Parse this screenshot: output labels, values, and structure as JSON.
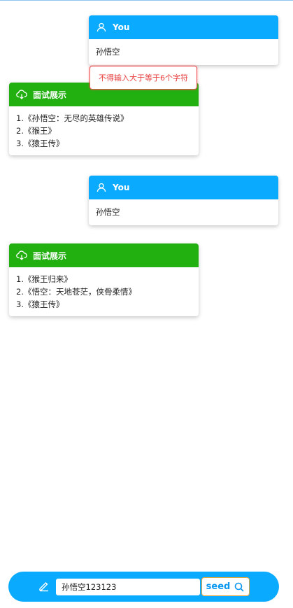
{
  "colors": {
    "user_header": "#0aaaff",
    "bot_header": "#22b011",
    "error": "#e83f3f",
    "bottom_bar": "#0aaaff",
    "seed_border": "#e8a33a"
  },
  "messages": [
    {
      "role": "user",
      "icon": "user-icon",
      "header": "You",
      "text": "孙悟空"
    },
    {
      "role": "bot",
      "icon": "cloud-download-icon",
      "header": "面试展示",
      "lines": [
        "1.《孙悟空：无尽的英雄传说》",
        "2.《猴王》",
        "3.《猿王传》"
      ]
    },
    {
      "role": "user",
      "icon": "user-icon",
      "header": "You",
      "text": "孙悟空"
    },
    {
      "role": "bot",
      "icon": "cloud-download-icon",
      "header": "面试展示",
      "lines": [
        "1.《猴王归来》",
        "2.《悟空：天地苍茫，侠骨柔情》",
        "3.《猿王传》"
      ]
    }
  ],
  "error_tip": "不得输入大于等于6个字符",
  "input": {
    "icon": "edit-icon",
    "value": "孙悟空123123",
    "placeholder": ""
  },
  "seed_button": {
    "label": "seed",
    "icon": "search-icon"
  }
}
